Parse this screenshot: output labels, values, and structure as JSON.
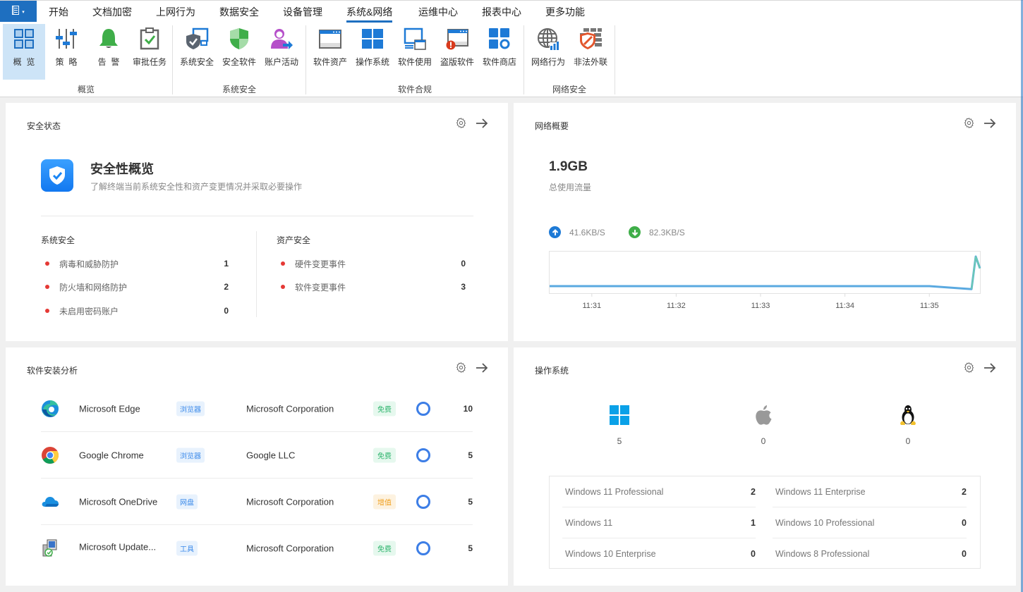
{
  "menubar": {
    "app_button_icon": "app-menu-icon",
    "tabs": [
      {
        "label": "开始"
      },
      {
        "label": "文档加密"
      },
      {
        "label": "上网行为"
      },
      {
        "label": "数据安全"
      },
      {
        "label": "设备管理"
      },
      {
        "label": "系统&网络",
        "active": true
      },
      {
        "label": "运维中心"
      },
      {
        "label": "报表中心"
      },
      {
        "label": "更多功能"
      }
    ]
  },
  "ribbon": {
    "groups": [
      {
        "label": "概览",
        "items": [
          {
            "label": "概  览",
            "icon": "overview-grid-icon",
            "selected": true
          },
          {
            "label": "策  略",
            "icon": "policy-sliders-icon"
          },
          {
            "label": "告  警",
            "icon": "alert-bell-icon"
          },
          {
            "label": "审批任务",
            "icon": "approval-clipboard-icon"
          }
        ]
      },
      {
        "label": "系统安全",
        "items": [
          {
            "label": "系统安全",
            "icon": "system-security-shield-icon"
          },
          {
            "label": "安全软件",
            "icon": "security-software-shield-icon"
          },
          {
            "label": "账户活动",
            "icon": "account-activity-user-icon"
          }
        ]
      },
      {
        "label": "软件合规",
        "items": [
          {
            "label": "软件资产",
            "icon": "software-asset-window-icon"
          },
          {
            "label": "操作系统",
            "icon": "operating-system-windows-icon"
          },
          {
            "label": "软件使用",
            "icon": "software-usage-monitor-icon"
          },
          {
            "label": "盗版软件",
            "icon": "pirated-software-warning-icon"
          },
          {
            "label": "软件商店",
            "icon": "software-store-icon"
          }
        ]
      },
      {
        "label": "网络安全",
        "items": [
          {
            "label": "网络行为",
            "icon": "network-behavior-globe-icon"
          },
          {
            "label": "非法外联",
            "icon": "illegal-connection-firewall-icon"
          }
        ]
      }
    ]
  },
  "cards": {
    "security": {
      "title": "安全状态",
      "hero_title": "安全性概览",
      "hero_subtitle": "了解终端当前系统安全性和资产变更情况并采取必要操作",
      "system": {
        "title": "系统安全",
        "rows": [
          {
            "label": "病毒和威胁防护",
            "value": "1"
          },
          {
            "label": "防火墙和网络防护",
            "value": "2"
          },
          {
            "label": "未启用密码账户",
            "value": "0"
          }
        ]
      },
      "asset": {
        "title": "资产安全",
        "rows": [
          {
            "label": "硬件变更事件",
            "value": "0"
          },
          {
            "label": "软件变更事件",
            "value": "3"
          }
        ]
      }
    },
    "network": {
      "title": "网络概要",
      "total": "1.9GB",
      "total_label": "总使用流量",
      "upload": "41.6KB/S",
      "download": "82.3KB/S",
      "colors": {
        "upload": "#1e7ad6",
        "download": "#3fae49",
        "line": "#5aa9e0",
        "spike": "#6fd3a8"
      }
    },
    "software": {
      "title": "软件安装分析",
      "rows": [
        {
          "name": "Microsoft Edge",
          "category": "浏览器",
          "vendor": "Microsoft Corporation",
          "license": "免费",
          "license_type": "free",
          "count": "10",
          "icon": "edge-icon"
        },
        {
          "name": "Google Chrome",
          "category": "浏览器",
          "vendor": "Google LLC",
          "license": "免费",
          "license_type": "free",
          "count": "5",
          "icon": "chrome-icon"
        },
        {
          "name": "Microsoft OneDrive",
          "category": "网盘",
          "vendor": "Microsoft Corporation",
          "license": "增值",
          "license_type": "paid",
          "count": "5",
          "icon": "onedrive-icon"
        },
        {
          "name": "Microsoft Update...",
          "category": "工具",
          "vendor": "Microsoft Corporation",
          "license": "免费",
          "license_type": "free",
          "count": "5",
          "icon": "installer-icon"
        }
      ]
    },
    "os": {
      "title": "操作系统",
      "platforms": [
        {
          "name": "windows",
          "count": "5",
          "icon": "windows-logo-icon"
        },
        {
          "name": "mac",
          "count": "0",
          "icon": "apple-logo-icon"
        },
        {
          "name": "linux",
          "count": "0",
          "icon": "linux-tux-icon"
        }
      ],
      "versions": [
        {
          "name": "Windows 11 Professional",
          "count": "2"
        },
        {
          "name": "Windows 11 Enterprise",
          "count": "2"
        },
        {
          "name": "Windows 11",
          "count": "1"
        },
        {
          "name": "Windows 10 Professional",
          "count": "0"
        },
        {
          "name": "Windows 10 Enterprise",
          "count": "0"
        },
        {
          "name": "Windows 8 Professional",
          "count": "0"
        }
      ]
    }
  },
  "chart_data": {
    "type": "line",
    "title": "",
    "xlabel": "",
    "ylabel": "",
    "x_ticks": [
      "11:31",
      "11:32",
      "11:33",
      "11:34",
      "11:35"
    ],
    "series": [
      {
        "name": "traffic",
        "x": [
          "11:30:30",
          "11:31",
          "11:32",
          "11:33",
          "11:34",
          "11:35",
          "11:35:30",
          "11:35:33",
          "11:35:36"
        ],
        "values": [
          0,
          0,
          0,
          0,
          0,
          0,
          -0.1,
          1.0,
          0.6
        ]
      }
    ],
    "grid": false,
    "legend": "none"
  }
}
